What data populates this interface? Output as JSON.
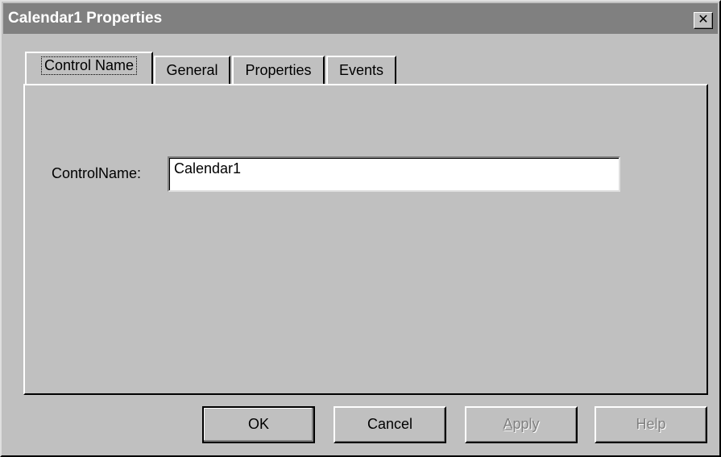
{
  "window": {
    "title": "Calendar1 Properties",
    "close_glyph": "✕"
  },
  "tabs": [
    {
      "label": "Control Name",
      "active": true
    },
    {
      "label": "General",
      "active": false
    },
    {
      "label": "Properties",
      "active": false
    },
    {
      "label": "Events",
      "active": false
    }
  ],
  "form": {
    "control_name_label": "ControlName:",
    "control_name_value": "Calendar1"
  },
  "buttons": {
    "ok": "OK",
    "cancel": "Cancel",
    "apply_mnemonic": "A",
    "apply_rest": "pply",
    "help": "Help"
  },
  "colors": {
    "face": "#c0c0c0",
    "title_bar": "#808080",
    "disabled_text": "#808080"
  },
  "icons": {
    "close": "close-icon"
  }
}
